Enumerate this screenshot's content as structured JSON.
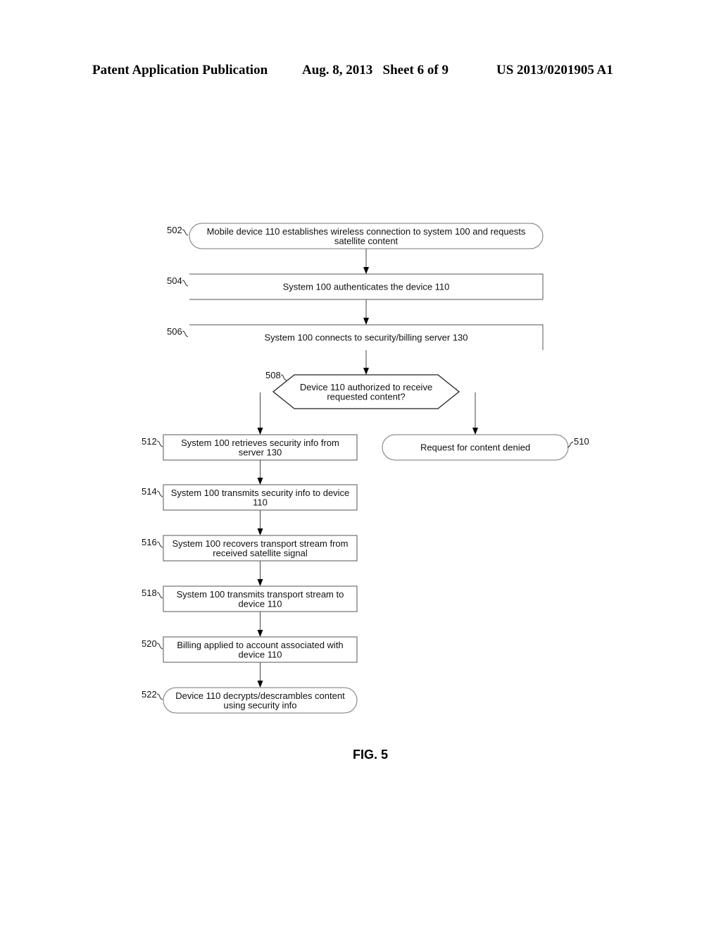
{
  "header": {
    "publication": "Patent Application Publication",
    "date_sheet": "Aug. 8, 2013   Sheet 6 of 9",
    "patent_number": "US 2013/0201905 A1"
  },
  "figure_label": "FIG. 5",
  "nodes": [
    {
      "id": "502",
      "ref": "502",
      "shape": "terminal",
      "lines": [
        "Mobile device 110 establishes wireless connection to system 100 and requests",
        "satellite content"
      ]
    },
    {
      "id": "504",
      "ref": "504",
      "shape": "process",
      "lines": [
        "System 100 authenticates the device 110"
      ]
    },
    {
      "id": "506",
      "ref": "506",
      "shape": "process",
      "lines": [
        "System 100 connects to security/billing server 130"
      ]
    },
    {
      "id": "508",
      "ref": "508",
      "shape": "decision",
      "lines": [
        "Device 110 authorized to receive",
        "requested content?"
      ]
    },
    {
      "id": "510",
      "ref": "510",
      "shape": "terminal",
      "lines": [
        "Request for content denied"
      ]
    },
    {
      "id": "512",
      "ref": "512",
      "shape": "process",
      "lines": [
        "System 100 retrieves security info from",
        "server 130"
      ]
    },
    {
      "id": "514",
      "ref": "514",
      "shape": "process",
      "lines": [
        "System 100 transmits security info to device",
        "110"
      ]
    },
    {
      "id": "516",
      "ref": "516",
      "shape": "process",
      "lines": [
        "System 100 recovers transport stream from",
        "received satellite signal"
      ]
    },
    {
      "id": "518",
      "ref": "518",
      "shape": "process",
      "lines": [
        "System 100 transmits transport stream to",
        "device 110"
      ]
    },
    {
      "id": "520",
      "ref": "520",
      "shape": "process",
      "lines": [
        "Billing applied to account associated with",
        "device 110"
      ]
    },
    {
      "id": "522",
      "ref": "522",
      "shape": "terminal",
      "lines": [
        "Device 110 decrypts/descrambles content",
        "using security info"
      ]
    }
  ],
  "edges": [
    {
      "from": "502",
      "to": "504"
    },
    {
      "from": "504",
      "to": "506"
    },
    {
      "from": "506",
      "to": "508"
    },
    {
      "from": "508",
      "to": "512"
    },
    {
      "from": "508",
      "to": "510"
    },
    {
      "from": "512",
      "to": "514"
    },
    {
      "from": "514",
      "to": "516"
    },
    {
      "from": "516",
      "to": "518"
    },
    {
      "from": "518",
      "to": "520"
    },
    {
      "from": "520",
      "to": "522"
    }
  ]
}
